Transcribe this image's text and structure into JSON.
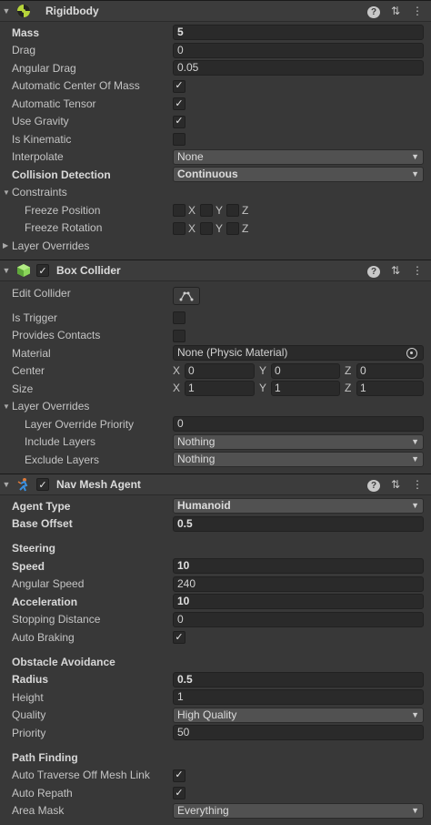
{
  "rigidbody": {
    "title": "Rigidbody",
    "mass_label": "Mass",
    "mass_value": "5",
    "drag_label": "Drag",
    "drag_value": "0",
    "angular_drag_label": "Angular Drag",
    "angular_drag_value": "0.05",
    "auto_com_label": "Automatic Center Of Mass",
    "auto_com_checked": true,
    "auto_tensor_label": "Automatic Tensor",
    "auto_tensor_checked": true,
    "use_gravity_label": "Use Gravity",
    "use_gravity_checked": true,
    "is_kinematic_label": "Is Kinematic",
    "is_kinematic_checked": false,
    "interpolate_label": "Interpolate",
    "interpolate_value": "None",
    "collision_detection_label": "Collision Detection",
    "collision_detection_value": "Continuous",
    "constraints_label": "Constraints",
    "freeze_position_label": "Freeze Position",
    "freeze_rotation_label": "Freeze Rotation",
    "axis_x": "X",
    "axis_y": "Y",
    "axis_z": "Z",
    "layer_overrides_label": "Layer Overrides"
  },
  "box_collider": {
    "title": "Box Collider",
    "edit_collider_label": "Edit Collider",
    "is_trigger_label": "Is Trigger",
    "provides_contacts_label": "Provides Contacts",
    "material_label": "Material",
    "material_value": "None (Physic Material)",
    "center_label": "Center",
    "center_x": "0",
    "center_y": "0",
    "center_z": "0",
    "size_label": "Size",
    "size_x": "1",
    "size_y": "1",
    "size_z": "1",
    "layer_overrides_label": "Layer Overrides",
    "layer_override_priority_label": "Layer Override Priority",
    "layer_override_priority_value": "0",
    "include_layers_label": "Include Layers",
    "include_layers_value": "Nothing",
    "exclude_layers_label": "Exclude Layers",
    "exclude_layers_value": "Nothing"
  },
  "nav_mesh_agent": {
    "title": "Nav Mesh Agent",
    "agent_type_label": "Agent Type",
    "agent_type_value": "Humanoid",
    "base_offset_label": "Base Offset",
    "base_offset_value": "0.5",
    "steering_label": "Steering",
    "speed_label": "Speed",
    "speed_value": "10",
    "angular_speed_label": "Angular Speed",
    "angular_speed_value": "240",
    "acceleration_label": "Acceleration",
    "acceleration_value": "10",
    "stopping_distance_label": "Stopping Distance",
    "stopping_distance_value": "0",
    "auto_braking_label": "Auto Braking",
    "auto_braking_checked": true,
    "obstacle_avoidance_label": "Obstacle Avoidance",
    "radius_label": "Radius",
    "radius_value": "0.5",
    "height_label": "Height",
    "height_value": "1",
    "quality_label": "Quality",
    "quality_value": "High Quality",
    "priority_label": "Priority",
    "priority_value": "50",
    "path_finding_label": "Path Finding",
    "auto_traverse_label": "Auto Traverse Off Mesh Link",
    "auto_traverse_checked": true,
    "auto_repath_label": "Auto Repath",
    "auto_repath_checked": true,
    "area_mask_label": "Area Mask",
    "area_mask_value": "Everything"
  },
  "icons": {
    "help": "help-icon",
    "presets": "presets-icon",
    "menu": "kebab-menu-icon",
    "checkmark": "✓"
  },
  "colors": {
    "background": "#383838",
    "header": "#3c3c3c",
    "field": "#2a2a2a",
    "dropdown": "#515151",
    "rigidbody_icon": "#b6d43a",
    "box_collider_icon": "#8bd65a",
    "nav_agent_icon": "#3a8fe0"
  }
}
